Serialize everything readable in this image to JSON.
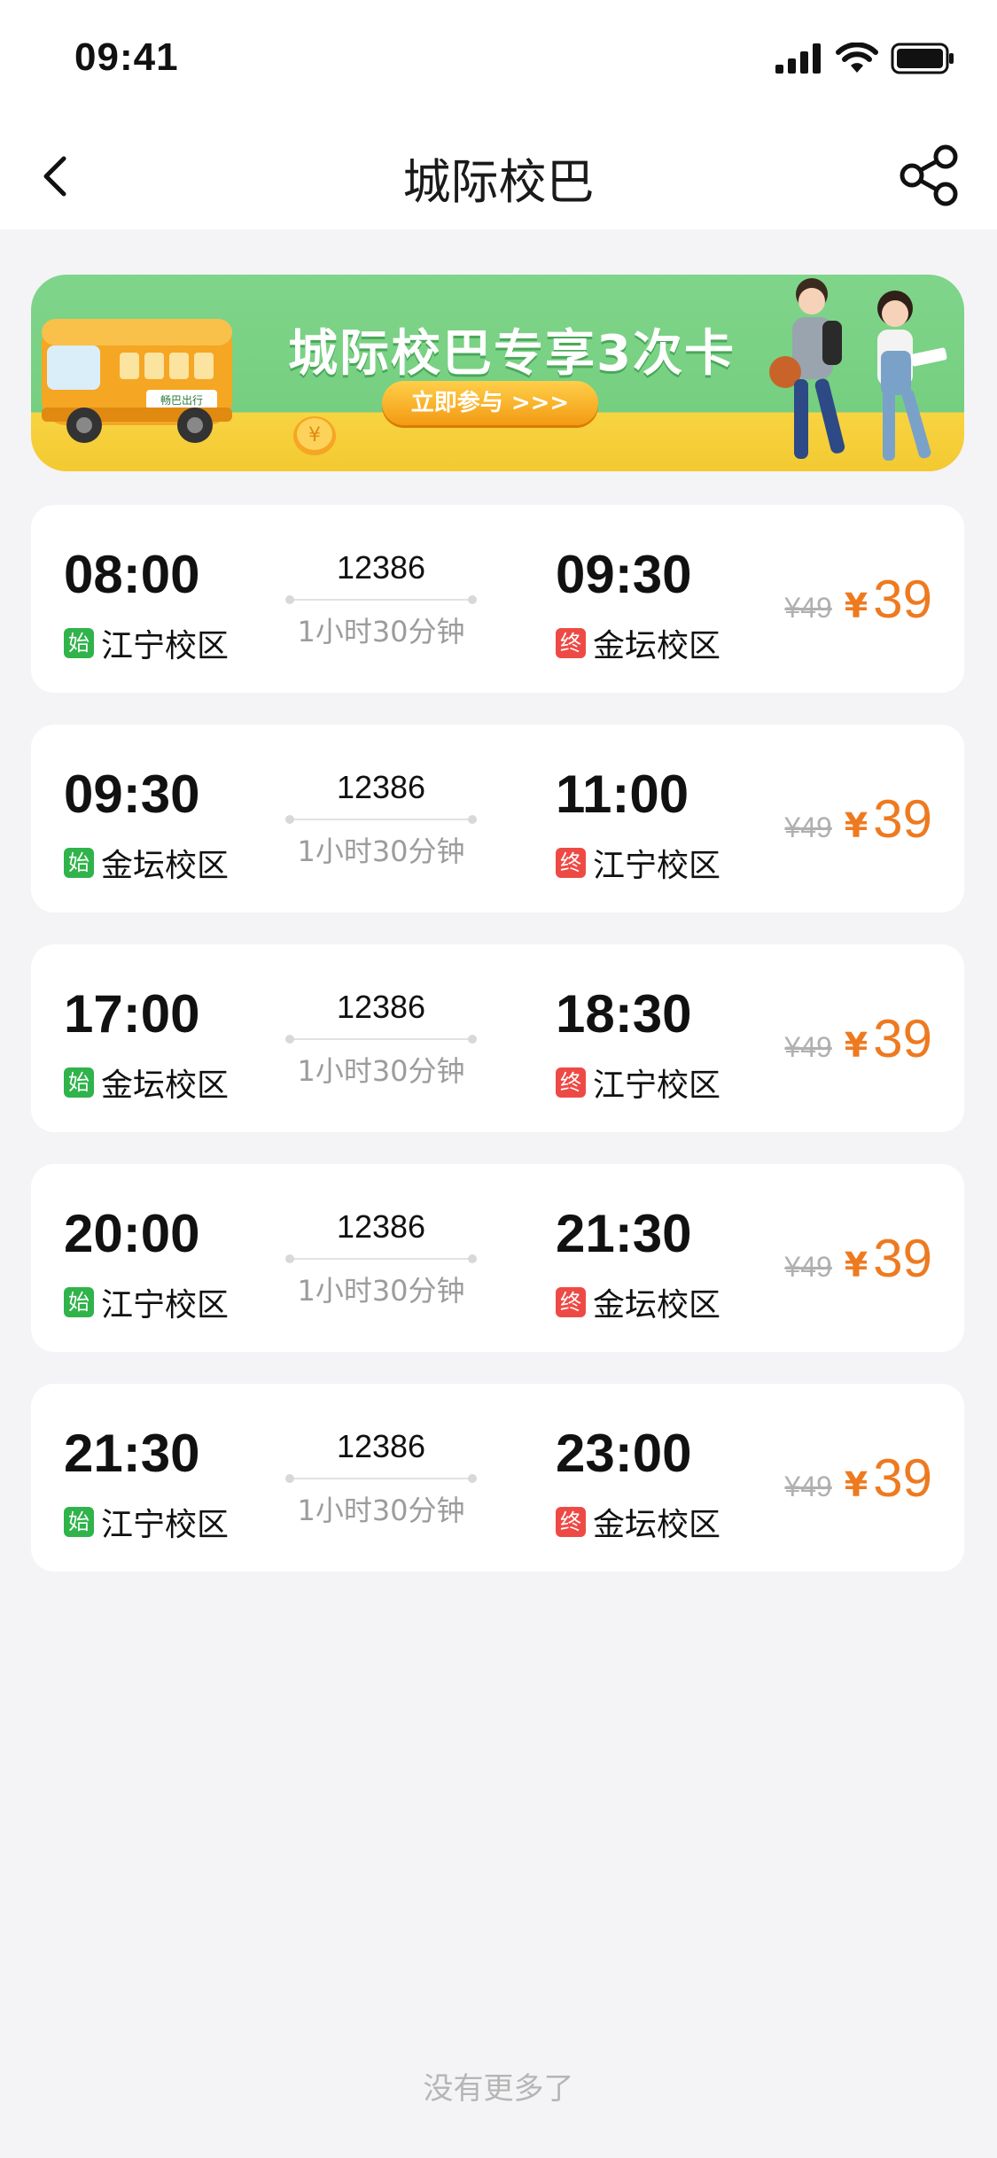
{
  "status_bar": {
    "time": "09:41"
  },
  "nav": {
    "title": "城际校巴"
  },
  "banner": {
    "title": "城际校巴专享3次卡",
    "button": "立即参与 >>>",
    "bus_logo": "畅巴出行"
  },
  "trips": [
    {
      "depart_time": "08:00",
      "depart_tag": "始",
      "depart_station": "江宁校区",
      "bus_no": "12386",
      "duration": "1小时30分钟",
      "arrive_time": "09:30",
      "arrive_tag": "终",
      "arrive_station": "金坛校区",
      "original_price": "¥49",
      "currency": "¥",
      "price": "39"
    },
    {
      "depart_time": "09:30",
      "depart_tag": "始",
      "depart_station": "金坛校区",
      "bus_no": "12386",
      "duration": "1小时30分钟",
      "arrive_time": "11:00",
      "arrive_tag": "终",
      "arrive_station": "江宁校区",
      "original_price": "¥49",
      "currency": "¥",
      "price": "39"
    },
    {
      "depart_time": "17:00",
      "depart_tag": "始",
      "depart_station": "金坛校区",
      "bus_no": "12386",
      "duration": "1小时30分钟",
      "arrive_time": "18:30",
      "arrive_tag": "终",
      "arrive_station": "江宁校区",
      "original_price": "¥49",
      "currency": "¥",
      "price": "39"
    },
    {
      "depart_time": "20:00",
      "depart_tag": "始",
      "depart_station": "江宁校区",
      "bus_no": "12386",
      "duration": "1小时30分钟",
      "arrive_time": "21:30",
      "arrive_tag": "终",
      "arrive_station": "金坛校区",
      "original_price": "¥49",
      "currency": "¥",
      "price": "39"
    },
    {
      "depart_time": "21:30",
      "depart_tag": "始",
      "depart_station": "江宁校区",
      "bus_no": "12386",
      "duration": "1小时30分钟",
      "arrive_time": "23:00",
      "arrive_tag": "终",
      "arrive_station": "金坛校区",
      "original_price": "¥49",
      "currency": "¥",
      "price": "39"
    }
  ],
  "footer": {
    "no_more": "没有更多了"
  },
  "colors": {
    "accent_price": "#ee7a20",
    "start_tag": "#2fb34a",
    "end_tag": "#ee4a45",
    "banner_green": "#7fd58a"
  },
  "icons": {
    "back": "chevron-left-icon",
    "share": "share-icon",
    "signal": "signal-icon",
    "wifi": "wifi-icon",
    "battery": "battery-icon"
  }
}
